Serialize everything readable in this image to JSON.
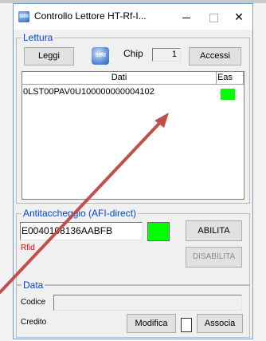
{
  "window": {
    "title": "Controllo Lettore HT-Rf-I...",
    "icon_text": "SIRI"
  },
  "lettura": {
    "group_label": "Lettura",
    "read_button": "Leggi",
    "siri_icon_text": "SIRI",
    "chip_label": "Chip",
    "chip_value": "1",
    "accessi_button": "Accessi",
    "columns": [
      "Dati",
      "Eas"
    ],
    "rows": [
      {
        "dati": "0LST00PAV0U100000000004102",
        "eas_color": "#00ff00"
      }
    ]
  },
  "antitaccheggio": {
    "group_label": "Antitaccheggio (AFI-direct)",
    "tag_value": "E0040108136AABFB",
    "status_color": "#00ff00",
    "rfid_label": "Rfid",
    "abilita_button": "ABILITA",
    "disabilita_button": "DISABILITA"
  },
  "data_section": {
    "group_label": "Data",
    "codice_label": "Codice",
    "codice_value": "",
    "credito_label": "Credito",
    "modifica_button": "Modifica",
    "associa_button": "Associa"
  },
  "colors": {
    "group_label": "#0046d5",
    "annotation_arrow": "#c0504d"
  }
}
